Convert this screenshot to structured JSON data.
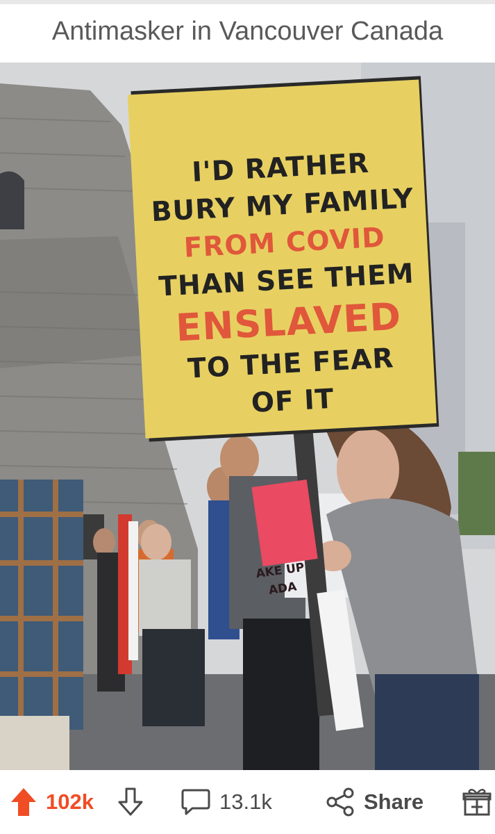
{
  "post": {
    "title": "Antimasker in Vancouver Canada"
  },
  "image": {
    "alt_description": "",
    "sign_lines": [
      "I'D RATHER",
      "BURY MY FAMILY",
      "FROM COVID",
      "THAN SEE THEM",
      "ENSLAVED",
      "TO THE FEAR",
      "OF IT"
    ],
    "small_sign_lines": [
      "AKE UP",
      "ADA"
    ]
  },
  "actions": {
    "upvote_count": "102k",
    "comment_count": "13.1k",
    "share_label": "Share"
  },
  "colors": {
    "upvote_active": "#f04d24",
    "text_gray": "#595959",
    "sign_yellow": "#e7d061",
    "sign_red": "#e0573b"
  }
}
